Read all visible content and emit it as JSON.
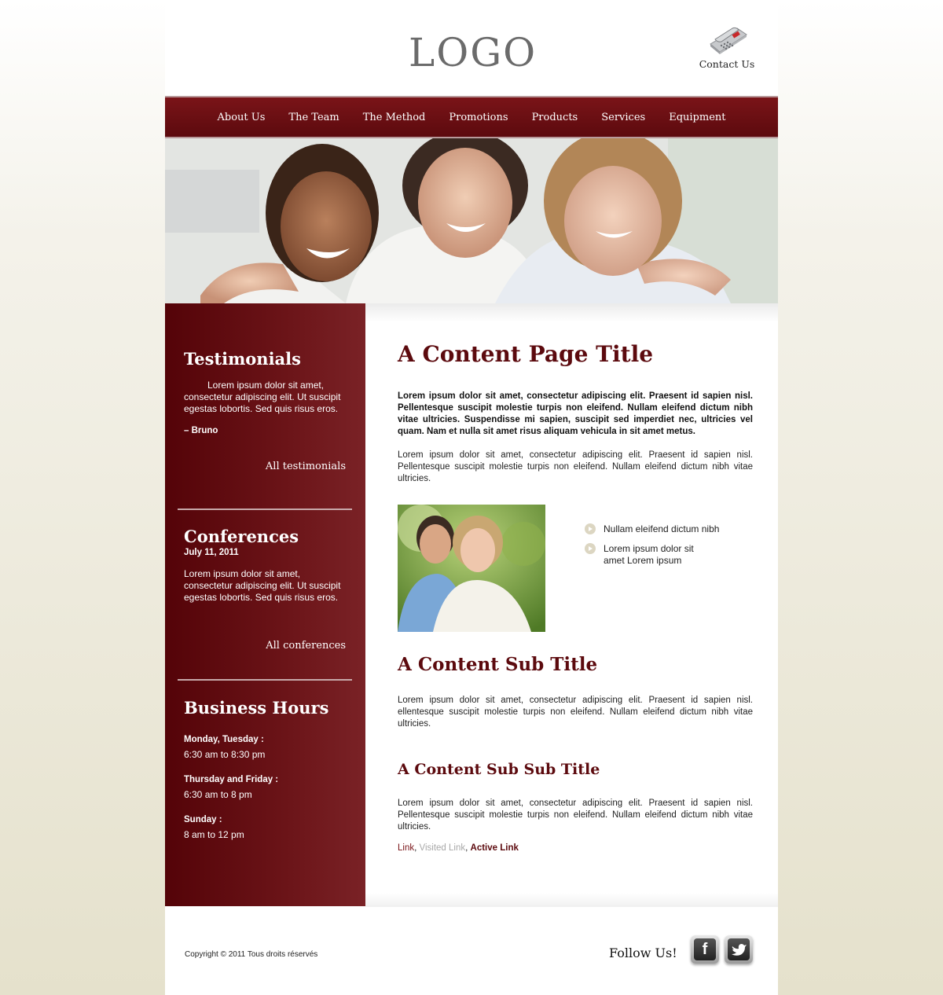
{
  "header": {
    "logo": "LOGO",
    "contact_label": "Contact Us"
  },
  "nav": {
    "items": [
      "About Us",
      "The Team",
      "The Method",
      "Promotions",
      "Products",
      "Services",
      "Equipment"
    ]
  },
  "sidebar": {
    "testimonials": {
      "title": "Testimonials",
      "text": "Lorem ipsum dolor sit amet, consectetur adipiscing elit. Ut suscipit egestas lobortis. Sed quis risus eros.",
      "author": "– Bruno",
      "link": "All testimonials"
    },
    "conferences": {
      "title": "Conferences",
      "date": "July 11, 2011",
      "text": "Lorem ipsum dolor sit amet, consectetur adipiscing elit. Ut suscipit egestas lobortis. Sed quis risus eros.",
      "link": "All conferences"
    },
    "hours": {
      "title": "Business Hours",
      "entries": [
        {
          "days": "Monday, Tuesday :",
          "time": "6:30 am to 8:30 pm"
        },
        {
          "days": "Thursday and Friday :",
          "time": "6:30 am to 8 pm"
        },
        {
          "days": "Sunday :",
          "time": "8 am to 12 pm"
        }
      ]
    }
  },
  "main": {
    "title": "A Content Page Title",
    "intro_bold": "Lorem ipsum dolor sit amet, consectetur adipiscing elit. Praesent id sapien nisl. Pellentesque suscipit molestie turpis non eleifend. Nullam eleifend dictum nibh vitae ultricies. Suspendisse mi sapien, suscipit sed imperdiet nec, ultricies vel quam. Nam et nulla sit amet risus aliquam vehicula in sit amet metus.",
    "paragraph1": "Lorem ipsum dolor sit amet, consectetur adipiscing elit. Praesent id sapien nisl. Pellentesque suscipit molestie turpis non eleifend. Nullam eleifend dictum nibh vitae ultricies.",
    "bullets": [
      "Nullam eleifend dictum nibh",
      "Lorem ipsum dolor sit amet Lorem ipsum"
    ],
    "subtitle": "A Content Sub Title",
    "paragraph2": "Lorem ipsum dolor sit amet, consectetur adipiscing elit. Praesent id sapien nisl. ellentesque suscipit molestie turpis non eleifend. Nullam eleifend dictum nibh vitae ultricies.",
    "subsubtitle": "A Content Sub Sub Title",
    "paragraph3": "Lorem ipsum dolor sit amet, consectetur adipiscing elit. Praesent id sapien nisl. Pellentesque suscipit molestie turpis non eleifend. Nullam eleifend dictum nibh vitae ultricies.",
    "links": {
      "link": "Link",
      "visited": "Visited Link",
      "active": "Active Link",
      "separator": ","
    }
  },
  "footer": {
    "copyright": "Copyright © 2011 Tous droits réservés",
    "follow": "Follow Us!",
    "facebook_glyph": "f",
    "twitter_glyph": "t"
  },
  "colors": {
    "brand": "#5c0a0e",
    "nav": "#6a0f13"
  },
  "icons": [
    "phone-icon",
    "facebook-icon",
    "twitter-icon",
    "arrow-bullet-icon"
  ]
}
